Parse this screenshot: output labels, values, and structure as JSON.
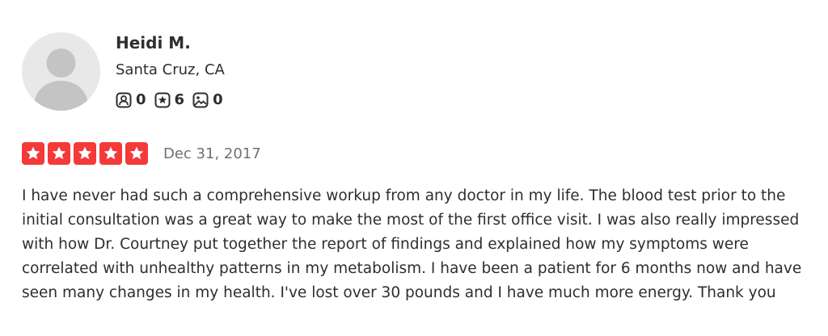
{
  "reviewer": {
    "name": "Heidi M.",
    "location": "Santa Cruz, CA",
    "stats": {
      "friends": {
        "icon": "friends-icon",
        "count": "0"
      },
      "reviews": {
        "icon": "review-star-icon",
        "count": "6"
      },
      "photos": {
        "icon": "photo-icon",
        "count": "0"
      }
    }
  },
  "review": {
    "rating": 5,
    "rating_max": 5,
    "star_color": "#f43939",
    "date": "Dec 31, 2017",
    "text": "I have never had such a comprehensive workup from any doctor in my life. The blood test prior to the initial consultation was a great way to make the most of the first office visit. I was also really impressed with how Dr. Courtney put together the report of findings and explained how my symptoms were correlated with unhealthy patterns in my metabolism. I have been a patient for 6 months now and have seen many changes in my health. I've lost over 30 pounds and I have much more energy. Thank you"
  }
}
